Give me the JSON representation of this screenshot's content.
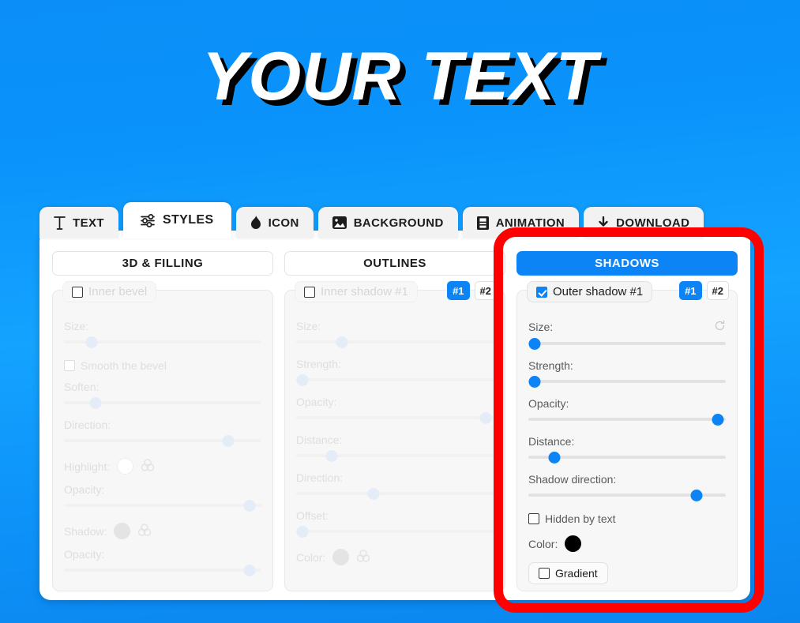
{
  "hero": {
    "text": "YOUR TEXT"
  },
  "colors": {
    "accent": "#0d84f5",
    "annotation": "#ff0000",
    "shadow_color": "#000000",
    "background_blue": "#0b8ef7"
  },
  "tabs": [
    {
      "label": "TEXT",
      "icon": "text-icon",
      "active": false
    },
    {
      "label": "STYLES",
      "icon": "sliders-icon",
      "active": true
    },
    {
      "label": "ICON",
      "icon": "flame-icon",
      "active": false
    },
    {
      "label": "BACKGROUND",
      "icon": "image-icon",
      "active": false
    },
    {
      "label": "ANIMATION",
      "icon": "film-icon",
      "active": false
    },
    {
      "label": "DOWNLOAD",
      "icon": "download-icon",
      "active": false
    }
  ],
  "subtabs": [
    {
      "label": "3D & FILLING",
      "active": false
    },
    {
      "label": "OUTLINES",
      "active": false
    },
    {
      "label": "SHADOWS",
      "active": true
    }
  ],
  "panels": {
    "inner_bevel": {
      "title": "Inner bevel",
      "checked": false,
      "enabled": false,
      "rows": {
        "size": "Size:",
        "smooth": "Smooth the bevel",
        "soften": "Soften:",
        "direction": "Direction:",
        "highlight": "Highlight:",
        "highlight_opacity": "Opacity:",
        "shadow": "Shadow:",
        "shadow_opacity": "Opacity:"
      }
    },
    "inner_shadow": {
      "title": "Inner shadow #1",
      "checked": false,
      "enabled": false,
      "badges": [
        {
          "label": "#1",
          "active": true
        },
        {
          "label": "#2",
          "active": false
        }
      ],
      "rows": {
        "size": "Size:",
        "strength": "Strength:",
        "opacity": "Opacity:",
        "distance": "Distance:",
        "direction": "Direction:",
        "offset": "Offset:",
        "color": "Color:"
      }
    },
    "outer_shadow": {
      "title": "Outer shadow #1",
      "checked": true,
      "enabled": true,
      "badges": [
        {
          "label": "#1",
          "active": true
        },
        {
          "label": "#2",
          "active": false
        }
      ],
      "rows": {
        "size": "Size:",
        "strength": "Strength:",
        "opacity": "Opacity:",
        "distance": "Distance:",
        "shadow_direction": "Shadow direction:",
        "hidden_by_text": "Hidden by text",
        "color": "Color:",
        "gradient": "Gradient"
      },
      "values": {
        "size_pct": 3,
        "strength_pct": 3,
        "opacity_pct": 96,
        "distance_pct": 13,
        "shadow_direction_pct": 85,
        "hidden_by_text": false,
        "color": "#000000",
        "gradient": false
      }
    }
  }
}
